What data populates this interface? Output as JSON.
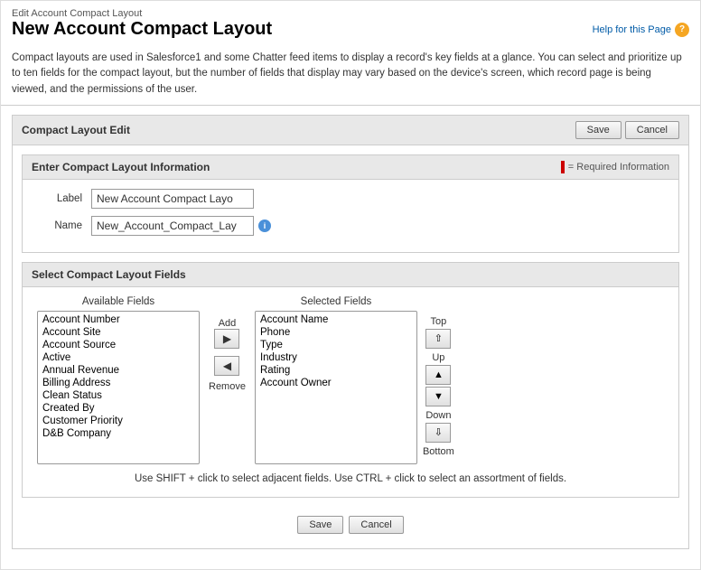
{
  "breadcrumb": "Edit Account Compact Layout",
  "page_title": "New Account Compact Layout",
  "help_link": "Help for this Page",
  "description": "Compact layouts are used in Salesforce1 and some Chatter feed items to display a record's key fields at a glance. You can select and prioritize up to ten fields for the compact layout, but the number of fields that display may vary based on the device's screen, which record page is being viewed, and the permissions of the user.",
  "sections": {
    "compact_layout_edit": {
      "title": "Compact Layout Edit",
      "save_btn": "Save",
      "cancel_btn": "Cancel"
    },
    "enter_info": {
      "title": "Enter Compact Layout Information",
      "required_label": "= Required Information",
      "label_field": {
        "label": "Label",
        "value": "New Account Compact Layo"
      },
      "name_field": {
        "label": "Name",
        "value": "New_Account_Compact_Lay"
      }
    },
    "select_fields": {
      "title": "Select Compact Layout Fields",
      "available_label": "Available Fields",
      "selected_label": "Selected Fields",
      "add_label": "Add",
      "remove_label": "Remove",
      "available_fields": [
        "Account Number",
        "Account Site",
        "Account Source",
        "Active",
        "Annual Revenue",
        "Billing Address",
        "Clean Status",
        "Created By",
        "Customer Priority",
        "D&B Company"
      ],
      "selected_fields": [
        "Account Name",
        "Phone",
        "Type",
        "Industry",
        "Rating",
        "Account Owner"
      ],
      "order_buttons": {
        "top": "Top",
        "up": "Up",
        "down": "Down",
        "bottom": "Bottom"
      },
      "hint": "Use SHIFT + click to select adjacent fields. Use CTRL + click to select an assortment of fields."
    }
  },
  "bottom_buttons": {
    "save": "Save",
    "cancel": "Cancel"
  }
}
